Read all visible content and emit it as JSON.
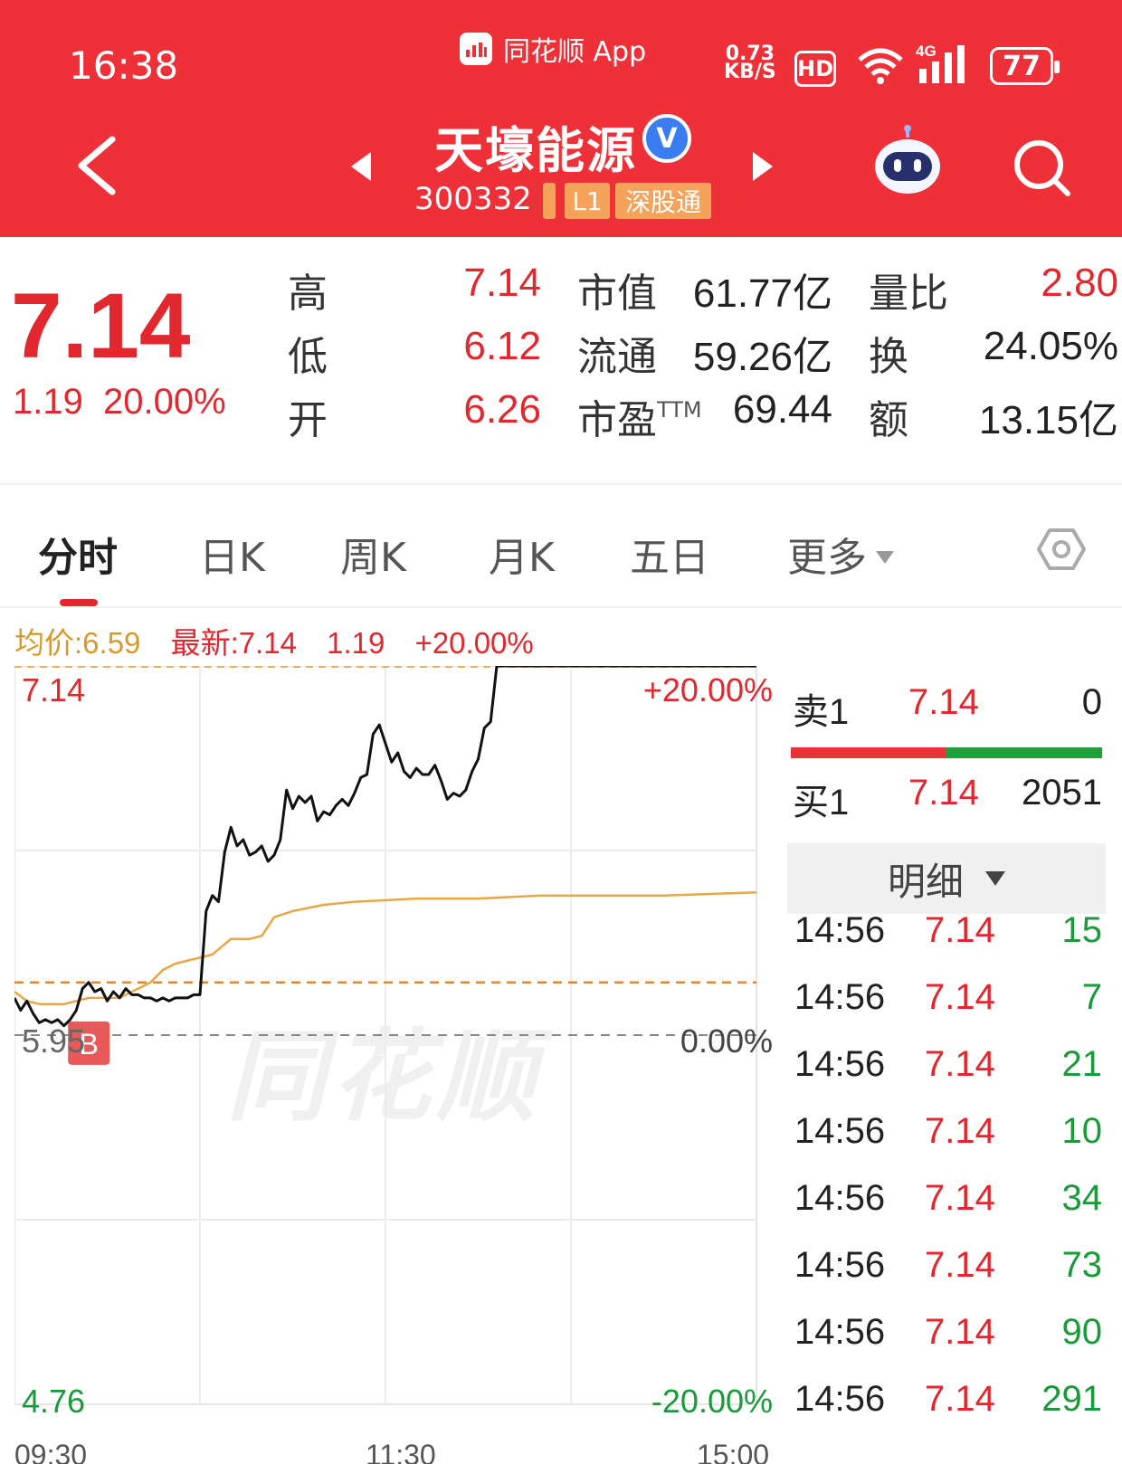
{
  "status_bar": {
    "time": "16:38",
    "app_name": "同花顺 App",
    "net_speed_value": "0.73",
    "net_speed_unit": "KB/S",
    "hd": "HD",
    "network": "4G",
    "battery": "77"
  },
  "header": {
    "stock_name": "天壕能源",
    "verified_mark": "V",
    "stock_code": "300332",
    "tag_level": "L1",
    "tag_connect": "深股通"
  },
  "quote": {
    "price": "7.14",
    "change": "1.19",
    "change_pct": "20.00%",
    "high_label": "高",
    "high": "7.14",
    "low_label": "低",
    "low": "6.12",
    "open_label": "开",
    "open": "6.26",
    "mktcap_label": "市值",
    "mktcap": "61.77亿",
    "float_label": "流通",
    "float": "59.26亿",
    "pe_label": "市盈",
    "pe_sup": "TTM",
    "pe": "69.44",
    "vol_ratio_label": "量比",
    "vol_ratio": "2.80",
    "turnover_label": "换",
    "turnover": "24.05%",
    "amount_label": "额",
    "amount": "13.15亿"
  },
  "tabs": [
    "分时",
    "日K",
    "周K",
    "月K",
    "五日",
    "更多"
  ],
  "info_line": {
    "avg": "均价:6.59",
    "latest": "最新:7.14",
    "change": "1.19",
    "change_pct": "+20.00%"
  },
  "chart_labels": {
    "top_price": "7.14",
    "top_pct": "+20.00%",
    "mid_price": "5.95",
    "mid_pct": "0.00%",
    "bottom_price": "4.76",
    "bottom_pct": "-20.00%",
    "buy_marker": "B",
    "watermark": "同花顺",
    "time_start": "09:30",
    "time_mid": "11:30",
    "time_end": "15:00"
  },
  "chart_data": {
    "type": "line",
    "ylim": [
      4.76,
      7.14
    ],
    "prev_close": 5.95,
    "x_ticks": [
      "09:30",
      "11:30",
      "15:00"
    ],
    "series": [
      {
        "color": "#111111",
        "x": [
          0,
          2,
          4,
          6,
          8,
          10,
          12,
          14,
          16,
          18,
          20,
          22,
          24,
          26,
          28,
          30,
          32,
          34,
          36,
          38,
          40,
          42,
          44,
          46,
          48,
          50,
          52,
          54,
          56,
          58,
          60,
          62,
          64,
          66,
          68,
          70,
          72,
          74,
          76,
          78,
          80,
          82,
          84,
          86,
          88,
          90,
          92,
          94,
          96,
          98,
          100,
          102,
          104,
          106,
          108,
          110,
          112,
          114,
          116,
          118,
          120,
          122,
          124,
          126,
          128,
          130,
          132,
          134,
          136,
          138,
          140,
          142,
          144,
          146,
          148,
          150,
          152,
          154,
          156,
          158,
          160,
          162,
          164,
          166,
          168,
          170,
          172,
          174,
          176,
          178,
          180,
          184,
          190,
          200,
          210,
          220,
          230,
          240
        ],
        "y": [
          6.07,
          6.03,
          6.06,
          6.02,
          5.99,
          6.0,
          5.99,
          6.0,
          5.98,
          6.0,
          6.03,
          6.1,
          6.12,
          6.09,
          6.1,
          6.06,
          6.09,
          6.07,
          6.1,
          6.08,
          6.08,
          6.07,
          6.07,
          6.06,
          6.07,
          6.06,
          6.07,
          6.07,
          6.07,
          6.08,
          6.08,
          6.35,
          6.4,
          6.38,
          6.54,
          6.62,
          6.56,
          6.58,
          6.53,
          6.54,
          6.56,
          6.51,
          6.53,
          6.58,
          6.74,
          6.68,
          6.72,
          6.7,
          6.72,
          6.64,
          6.67,
          6.66,
          6.69,
          6.71,
          6.69,
          6.73,
          6.78,
          6.79,
          6.92,
          6.95,
          6.89,
          6.83,
          6.86,
          6.8,
          6.78,
          6.81,
          6.79,
          6.79,
          6.82,
          6.77,
          6.71,
          6.73,
          6.72,
          6.74,
          6.8,
          6.84,
          6.94,
          6.96,
          7.14,
          7.14,
          7.14,
          7.14,
          7.14,
          7.14,
          7.14,
          7.14,
          7.14,
          7.14,
          7.14,
          7.14,
          7.14,
          7.14,
          7.14,
          7.14,
          7.14,
          7.14,
          7.14,
          7.14
        ]
      },
      {
        "color": "#e8a645",
        "x": [
          0,
          4,
          8,
          12,
          16,
          20,
          24,
          28,
          30,
          32,
          34,
          36,
          38,
          40,
          44,
          48,
          52,
          56,
          60,
          64,
          70,
          76,
          80,
          84,
          90,
          100,
          110,
          130,
          150,
          170,
          190,
          210,
          240
        ],
        "y": [
          6.09,
          6.06,
          6.05,
          6.05,
          6.05,
          6.06,
          6.07,
          6.07,
          6.07,
          6.07,
          6.07,
          6.08,
          6.09,
          6.1,
          6.12,
          6.16,
          6.18,
          6.19,
          6.2,
          6.21,
          6.26,
          6.26,
          6.27,
          6.33,
          6.35,
          6.37,
          6.38,
          6.39,
          6.39,
          6.4,
          6.4,
          6.4,
          6.41
        ]
      }
    ],
    "reference_lines": [
      {
        "y": 5.95,
        "style": "dashed"
      },
      {
        "y": 6.12,
        "style": "dashed-orange"
      }
    ]
  },
  "order_book": {
    "sell1_label": "卖1",
    "sell1_price": "7.14",
    "sell1_vol": "0",
    "buy1_label": "买1",
    "buy1_price": "7.14",
    "buy1_vol": "2051",
    "bar_red_fraction": 0.5,
    "detail_label": "明细"
  },
  "ticks": [
    {
      "time": "14:56",
      "price": "7.14",
      "vol": "15"
    },
    {
      "time": "14:56",
      "price": "7.14",
      "vol": "7"
    },
    {
      "time": "14:56",
      "price": "7.14",
      "vol": "21"
    },
    {
      "time": "14:56",
      "price": "7.14",
      "vol": "10"
    },
    {
      "time": "14:56",
      "price": "7.14",
      "vol": "34"
    },
    {
      "time": "14:56",
      "price": "7.14",
      "vol": "73"
    },
    {
      "time": "14:56",
      "price": "7.14",
      "vol": "90"
    },
    {
      "time": "14:56",
      "price": "7.14",
      "vol": "291"
    }
  ]
}
